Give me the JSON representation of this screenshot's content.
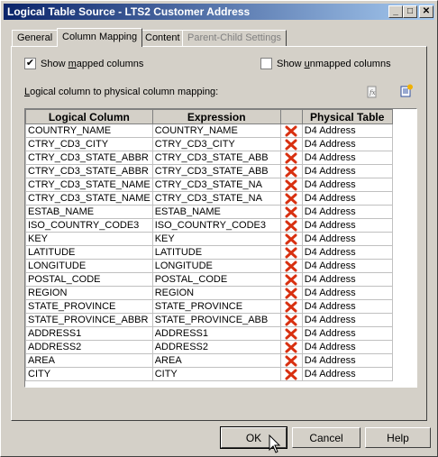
{
  "window": {
    "title": "Logical Table Source - LTS2 Customer Address"
  },
  "title_buttons": {
    "minimize": "_",
    "maximize": "□",
    "close": "✕"
  },
  "tabs": [
    {
      "label": "General",
      "state": "normal"
    },
    {
      "label": "Column Mapping",
      "state": "active"
    },
    {
      "label": "Content",
      "state": "normal"
    },
    {
      "label": "Parent-Child Settings",
      "state": "disabled"
    }
  ],
  "options": {
    "show_mapped": {
      "pre": "Show ",
      "ul": "m",
      "post": "apped columns",
      "checked": true,
      "mark": "✔"
    },
    "show_unmapped": {
      "pre": "Show ",
      "ul": "u",
      "post": "nmapped columns",
      "checked": false,
      "mark": ""
    }
  },
  "mapping_label": {
    "pre": "",
    "ul": "L",
    "post": "ogical column to physical column mapping:"
  },
  "toolbar": {
    "icons": [
      "expression-builder-icon",
      "new-mapping-icon"
    ]
  },
  "grid": {
    "headers": [
      "Logical Column",
      "Expression",
      "",
      "Physical Table"
    ],
    "rows": [
      {
        "logical": "COUNTRY_NAME",
        "expression": "COUNTRY_NAME",
        "table": "D4 Address"
      },
      {
        "logical": "CTRY_CD3_CITY",
        "expression": "CTRY_CD3_CITY",
        "table": "D4 Address"
      },
      {
        "logical": "CTRY_CD3_STATE_ABBR",
        "expression": "CTRY_CD3_STATE_ABB",
        "table": "D4 Address"
      },
      {
        "logical": "CTRY_CD3_STATE_ABBR",
        "expression": "CTRY_CD3_STATE_ABB",
        "table": "D4 Address"
      },
      {
        "logical": "CTRY_CD3_STATE_NAME",
        "expression": "CTRY_CD3_STATE_NA",
        "table": "D4 Address"
      },
      {
        "logical": "CTRY_CD3_STATE_NAME",
        "expression": "CTRY_CD3_STATE_NA",
        "table": "D4 Address"
      },
      {
        "logical": "ESTAB_NAME",
        "expression": "ESTAB_NAME",
        "table": "D4 Address"
      },
      {
        "logical": "ISO_COUNTRY_CODE3",
        "expression": "ISO_COUNTRY_CODE3",
        "table": "D4 Address"
      },
      {
        "logical": "KEY",
        "expression": "KEY",
        "table": "D4 Address"
      },
      {
        "logical": "LATITUDE",
        "expression": "LATITUDE",
        "table": "D4 Address"
      },
      {
        "logical": "LONGITUDE",
        "expression": "LONGITUDE",
        "table": "D4 Address"
      },
      {
        "logical": "POSTAL_CODE",
        "expression": "POSTAL_CODE",
        "table": "D4 Address"
      },
      {
        "logical": "REGION",
        "expression": "REGION",
        "table": "D4 Address"
      },
      {
        "logical": "STATE_PROVINCE",
        "expression": "STATE_PROVINCE",
        "table": "D4 Address"
      },
      {
        "logical": "STATE_PROVINCE_ABBR",
        "expression": "STATE_PROVINCE_ABB",
        "table": "D4 Address"
      },
      {
        "logical": "ADDRESS1",
        "expression": "ADDRESS1",
        "table": "D4 Address"
      },
      {
        "logical": "ADDRESS2",
        "expression": "ADDRESS2",
        "table": "D4 Address"
      },
      {
        "logical": "AREA",
        "expression": "AREA",
        "table": "D4 Address"
      },
      {
        "logical": "CITY",
        "expression": "CITY",
        "table": "D4 Address"
      }
    ],
    "delete_icon": "delete-x-icon"
  },
  "buttons": {
    "ok": "OK",
    "cancel": "Cancel",
    "help": "Help"
  },
  "colors": {
    "titlebar_start": "#0a246a",
    "titlebar_end": "#a6caf0",
    "face": "#d4d0c8",
    "delete_red": "#d83010"
  }
}
